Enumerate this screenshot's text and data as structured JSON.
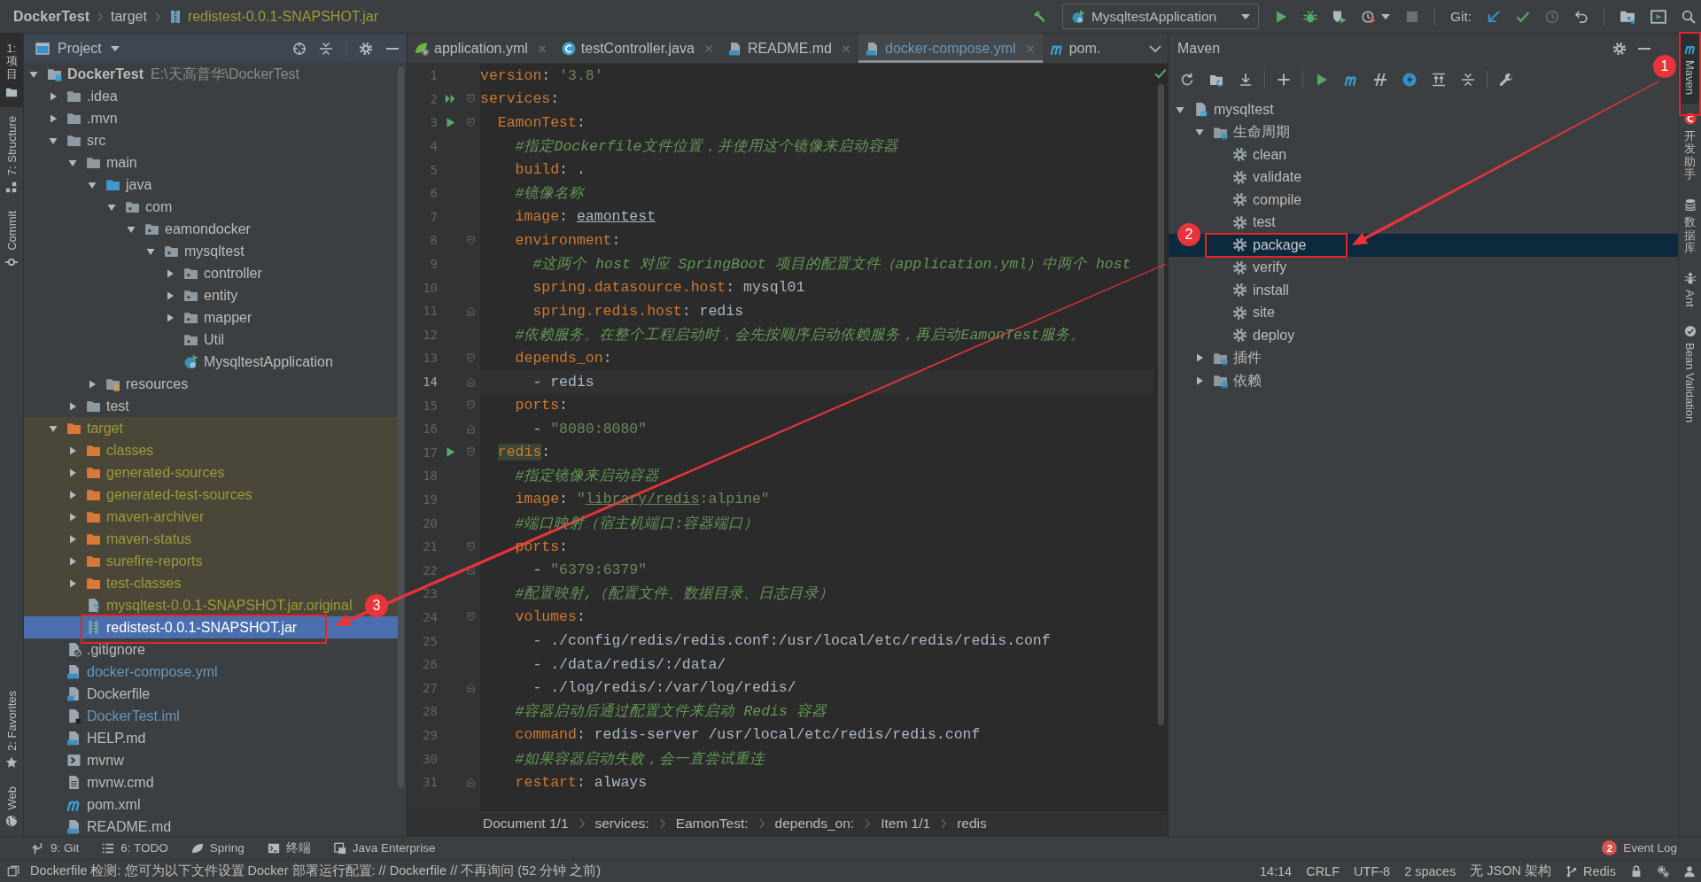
{
  "breadcrumb": [
    {
      "label": "DockerTest",
      "kind": "project"
    },
    {
      "label": "target",
      "kind": "folder"
    },
    {
      "label": "redistest-0.0.1-SNAPSHOT.jar",
      "kind": "jar"
    }
  ],
  "toolbar": {
    "run_config": "MysqltestApplication",
    "git_label": "Git:"
  },
  "left_strip": {
    "top": [
      {
        "label": "1: 项目",
        "kind": "project",
        "selected": true
      },
      {
        "label": "7: Structure",
        "kind": "structure",
        "selected": false
      },
      {
        "label": "Commit",
        "kind": "commit",
        "selected": false
      }
    ],
    "bottom": [
      {
        "label": "2: Favorites",
        "kind": "favorites",
        "selected": false
      },
      {
        "label": "Web",
        "kind": "web",
        "selected": false
      }
    ]
  },
  "project_panel": {
    "title": "Project",
    "tree": [
      {
        "label": "DockerTest",
        "path": "E:\\天高普华\\DockerTest",
        "kind": "module",
        "excluded": false,
        "modified": false,
        "expanded": true,
        "selected": false,
        "children": [
          {
            "label": ".idea",
            "kind": "folder",
            "excluded": false,
            "modified": false,
            "expanded": false,
            "selected": false
          },
          {
            "label": ".mvn",
            "kind": "folder",
            "excluded": false,
            "modified": false,
            "expanded": false,
            "selected": false
          },
          {
            "label": "src",
            "kind": "folder",
            "excluded": false,
            "modified": false,
            "expanded": true,
            "selected": false,
            "children": [
              {
                "label": "main",
                "kind": "folder",
                "excluded": false,
                "modified": false,
                "expanded": true,
                "selected": false,
                "children": [
                  {
                    "label": "java",
                    "kind": "source-root",
                    "excluded": false,
                    "modified": false,
                    "expanded": true,
                    "selected": false,
                    "children": [
                      {
                        "label": "com",
                        "kind": "package",
                        "excluded": false,
                        "modified": false,
                        "expanded": true,
                        "selected": false,
                        "children": [
                          {
                            "label": "eamondocker",
                            "kind": "package",
                            "excluded": false,
                            "modified": false,
                            "expanded": true,
                            "selected": false,
                            "children": [
                              {
                                "label": "mysqltest",
                                "kind": "package",
                                "excluded": false,
                                "modified": false,
                                "expanded": true,
                                "selected": false,
                                "children": [
                                  {
                                    "label": "controller",
                                    "kind": "package",
                                    "excluded": false,
                                    "modified": false,
                                    "expanded": false,
                                    "selected": false
                                  },
                                  {
                                    "label": "entity",
                                    "kind": "package",
                                    "excluded": false,
                                    "modified": false,
                                    "expanded": false,
                                    "selected": false
                                  },
                                  {
                                    "label": "mapper",
                                    "kind": "package",
                                    "excluded": false,
                                    "modified": false,
                                    "expanded": false,
                                    "selected": false
                                  },
                                  {
                                    "label": "Util",
                                    "kind": "package",
                                    "excluded": false,
                                    "modified": false,
                                    "selected": false
                                  },
                                  {
                                    "label": "MysqltestApplication",
                                    "kind": "spring-app",
                                    "excluded": false,
                                    "modified": false,
                                    "selected": false
                                  }
                                ]
                              }
                            ]
                          }
                        ]
                      }
                    ]
                  },
                  {
                    "label": "resources",
                    "kind": "resources-root",
                    "excluded": false,
                    "modified": false,
                    "expanded": false,
                    "selected": false
                  }
                ]
              },
              {
                "label": "test",
                "kind": "folder",
                "excluded": false,
                "modified": false,
                "expanded": false,
                "selected": false
              }
            ]
          },
          {
            "label": "target",
            "kind": "folder",
            "excluded": true,
            "modified": false,
            "expanded": true,
            "selected": false,
            "children": [
              {
                "label": "classes",
                "kind": "folder",
                "excluded": true,
                "modified": false,
                "expanded": false,
                "selected": false
              },
              {
                "label": "generated-sources",
                "kind": "folder",
                "excluded": true,
                "modified": false,
                "expanded": false,
                "selected": false
              },
              {
                "label": "generated-test-sources",
                "kind": "folder",
                "excluded": true,
                "modified": false,
                "expanded": false,
                "selected": false
              },
              {
                "label": "maven-archiver",
                "kind": "folder",
                "excluded": true,
                "modified": false,
                "expanded": false,
                "selected": false
              },
              {
                "label": "maven-status",
                "kind": "folder",
                "excluded": true,
                "modified": false,
                "expanded": false,
                "selected": false
              },
              {
                "label": "surefire-reports",
                "kind": "folder",
                "excluded": true,
                "modified": false,
                "expanded": false,
                "selected": false
              },
              {
                "label": "test-classes",
                "kind": "folder",
                "excluded": true,
                "modified": false,
                "expanded": false,
                "selected": false
              },
              {
                "label": "mysqltest-0.0.1-SNAPSHOT.jar.original",
                "kind": "unknown-file",
                "excluded": true,
                "modified": false,
                "selected": false
              },
              {
                "label": "redistest-0.0.1-SNAPSHOT.jar",
                "kind": "archive",
                "excluded": true,
                "modified": false,
                "selected": true
              }
            ]
          },
          {
            "label": ".gitignore",
            "kind": "ignore-file",
            "excluded": false,
            "modified": false,
            "selected": false
          },
          {
            "label": "docker-compose.yml",
            "kind": "compose-file",
            "excluded": false,
            "modified": true,
            "selected": false
          },
          {
            "label": "Dockerfile",
            "kind": "dockerfile",
            "excluded": false,
            "modified": false,
            "selected": false
          },
          {
            "label": "DockerTest.iml",
            "kind": "module-file",
            "excluded": false,
            "modified": true,
            "selected": false
          },
          {
            "label": "HELP.md",
            "kind": "markdown",
            "excluded": false,
            "modified": false,
            "selected": false
          },
          {
            "label": "mvnw",
            "kind": "shell-script",
            "excluded": false,
            "modified": false,
            "selected": false
          },
          {
            "label": "mvnw.cmd",
            "kind": "text-file",
            "excluded": false,
            "modified": false,
            "selected": false
          },
          {
            "label": "pom.xml",
            "kind": "maven-pom",
            "excluded": false,
            "modified": false,
            "selected": false
          },
          {
            "label": "README.md",
            "kind": "markdown",
            "excluded": false,
            "modified": false,
            "selected": false
          }
        ]
      }
    ]
  },
  "editor": {
    "tabs": [
      {
        "label": "application.yml",
        "kind": "spring-yaml",
        "modified": false,
        "selected": false,
        "closable": true
      },
      {
        "label": "testController.java",
        "kind": "class",
        "modified": false,
        "selected": false,
        "closable": true
      },
      {
        "label": "README.md",
        "kind": "markdown",
        "modified": false,
        "selected": false,
        "closable": true
      },
      {
        "label": "docker-compose.yml",
        "kind": "compose-file",
        "modified": true,
        "selected": true,
        "closable": true
      },
      {
        "label": "pom.",
        "kind": "maven-pom",
        "modified": false,
        "selected": false,
        "closable": false
      }
    ],
    "lines": [
      {
        "number": "1",
        "current": false,
        "run": false,
        "run_all": false,
        "fold_start": false,
        "fold_end": false,
        "tokens": [
          {
            "kind": "key",
            "text": "version"
          },
          {
            "kind": "plain",
            "text": ": "
          },
          {
            "kind": "string",
            "text": "'3.8'"
          }
        ]
      },
      {
        "number": "2",
        "current": false,
        "run": false,
        "run_all": true,
        "fold_start": true,
        "fold_end": false,
        "tokens": [
          {
            "kind": "key",
            "text": "services"
          },
          {
            "kind": "plain",
            "text": ":"
          }
        ]
      },
      {
        "number": "3",
        "current": false,
        "run": true,
        "run_all": false,
        "fold_start": true,
        "fold_end": false,
        "tokens": [
          {
            "kind": "key",
            "text": "  EamonTest"
          },
          {
            "kind": "plain",
            "text": ":"
          }
        ]
      },
      {
        "number": "4",
        "current": false,
        "run": false,
        "run_all": false,
        "fold_start": false,
        "fold_end": false,
        "tokens": [
          {
            "kind": "comment",
            "text": "    #指定Dockerfile文件位置，并使用这个镜像来启动容器"
          }
        ]
      },
      {
        "number": "5",
        "current": false,
        "run": false,
        "run_all": false,
        "fold_start": false,
        "fold_end": false,
        "tokens": [
          {
            "kind": "key",
            "text": "    build"
          },
          {
            "kind": "plain",
            "text": ": ."
          }
        ]
      },
      {
        "number": "6",
        "current": false,
        "run": false,
        "run_all": false,
        "fold_start": false,
        "fold_end": false,
        "tokens": [
          {
            "kind": "comment",
            "text": "    #镜像名称"
          }
        ]
      },
      {
        "number": "7",
        "current": false,
        "run": false,
        "run_all": false,
        "fold_start": false,
        "fold_end": false,
        "tokens": [
          {
            "kind": "key",
            "text": "    image"
          },
          {
            "kind": "plain",
            "text": ": "
          },
          {
            "kind": "link",
            "text": "eamontest"
          }
        ]
      },
      {
        "number": "8",
        "current": false,
        "run": false,
        "run_all": false,
        "fold_start": true,
        "fold_end": false,
        "tokens": [
          {
            "kind": "key",
            "text": "    environment"
          },
          {
            "kind": "plain",
            "text": ":"
          }
        ]
      },
      {
        "number": "9",
        "current": false,
        "run": false,
        "run_all": false,
        "fold_start": false,
        "fold_end": false,
        "tokens": [
          {
            "kind": "comment",
            "text": "      #这两个 host 对应 SpringBoot 项目的配置文件（application.yml）中两个 host"
          }
        ]
      },
      {
        "number": "10",
        "current": false,
        "run": false,
        "run_all": false,
        "fold_start": false,
        "fold_end": false,
        "tokens": [
          {
            "kind": "key",
            "text": "      spring.datasource.host"
          },
          {
            "kind": "plain",
            "text": ": mysql01"
          }
        ]
      },
      {
        "number": "11",
        "current": false,
        "run": false,
        "run_all": false,
        "fold_start": false,
        "fold_end": true,
        "tokens": [
          {
            "kind": "key",
            "text": "      spring.redis.host"
          },
          {
            "kind": "plain",
            "text": ": redis"
          }
        ]
      },
      {
        "number": "12",
        "current": false,
        "run": false,
        "run_all": false,
        "fold_start": false,
        "fold_end": false,
        "tokens": [
          {
            "kind": "comment",
            "text": "    #依赖服务。在整个工程启动时，会先按顺序启动依赖服务，再启动EamonTest服务。"
          }
        ]
      },
      {
        "number": "13",
        "current": false,
        "run": false,
        "run_all": false,
        "fold_start": true,
        "fold_end": false,
        "tokens": [
          {
            "kind": "key",
            "text": "    depends_on"
          },
          {
            "kind": "plain",
            "text": ":"
          }
        ]
      },
      {
        "number": "14",
        "current": true,
        "run": false,
        "run_all": false,
        "fold_start": false,
        "fold_end": true,
        "tokens": [
          {
            "kind": "plain",
            "text": "      - redis"
          }
        ]
      },
      {
        "number": "15",
        "current": false,
        "run": false,
        "run_all": false,
        "fold_start": true,
        "fold_end": false,
        "tokens": [
          {
            "kind": "key",
            "text": "    ports"
          },
          {
            "kind": "plain",
            "text": ":"
          }
        ]
      },
      {
        "number": "16",
        "current": false,
        "run": false,
        "run_all": false,
        "fold_start": false,
        "fold_end": true,
        "tokens": [
          {
            "kind": "plain",
            "text": "      - "
          },
          {
            "kind": "string",
            "text": "\"8080:8080\""
          }
        ]
      },
      {
        "number": "17",
        "current": false,
        "run": true,
        "run_all": false,
        "fold_start": true,
        "fold_end": false,
        "tokens": [
          {
            "kind": "key-marked",
            "text": "  redis"
          },
          {
            "kind": "plain",
            "text": ":"
          }
        ]
      },
      {
        "number": "18",
        "current": false,
        "run": false,
        "run_all": false,
        "fold_start": false,
        "fold_end": false,
        "tokens": [
          {
            "kind": "comment",
            "text": "    #指定镜像来启动容器"
          }
        ]
      },
      {
        "number": "19",
        "current": false,
        "run": false,
        "run_all": false,
        "fold_start": false,
        "fold_end": false,
        "tokens": [
          {
            "kind": "key",
            "text": "    image"
          },
          {
            "kind": "plain",
            "text": ": "
          },
          {
            "kind": "string",
            "text": "\""
          },
          {
            "kind": "string-link",
            "text": "library/redis"
          },
          {
            "kind": "string",
            "text": ":alpine\""
          }
        ]
      },
      {
        "number": "20",
        "current": false,
        "run": false,
        "run_all": false,
        "fold_start": false,
        "fold_end": false,
        "tokens": [
          {
            "kind": "comment",
            "text": "    #端口映射（宿主机端口:容器端口）"
          }
        ]
      },
      {
        "number": "21",
        "current": false,
        "run": false,
        "run_all": false,
        "fold_start": true,
        "fold_end": false,
        "tokens": [
          {
            "kind": "key",
            "text": "    ports"
          },
          {
            "kind": "plain",
            "text": ":"
          }
        ]
      },
      {
        "number": "22",
        "current": false,
        "run": false,
        "run_all": false,
        "fold_start": false,
        "fold_end": true,
        "tokens": [
          {
            "kind": "plain",
            "text": "      - "
          },
          {
            "kind": "string",
            "text": "\"6379:6379\""
          }
        ]
      },
      {
        "number": "23",
        "current": false,
        "run": false,
        "run_all": false,
        "fold_start": false,
        "fold_end": false,
        "tokens": [
          {
            "kind": "comment",
            "text": "    #配置映射,（配置文件、数据目录、日志目录）"
          }
        ]
      },
      {
        "number": "24",
        "current": false,
        "run": false,
        "run_all": false,
        "fold_start": true,
        "fold_end": false,
        "tokens": [
          {
            "kind": "key",
            "text": "    volumes"
          },
          {
            "kind": "plain",
            "text": ":"
          }
        ]
      },
      {
        "number": "25",
        "current": false,
        "run": false,
        "run_all": false,
        "fold_start": false,
        "fold_end": false,
        "tokens": [
          {
            "kind": "plain",
            "text": "      - ./config/redis/redis.conf:/usr/local/etc/redis/redis.conf"
          }
        ]
      },
      {
        "number": "26",
        "current": false,
        "run": false,
        "run_all": false,
        "fold_start": false,
        "fold_end": false,
        "tokens": [
          {
            "kind": "plain",
            "text": "      - ./data/redis/:/data/"
          }
        ]
      },
      {
        "number": "27",
        "current": false,
        "run": false,
        "run_all": false,
        "fold_start": false,
        "fold_end": true,
        "tokens": [
          {
            "kind": "plain",
            "text": "      - ./log/redis/:/var/log/redis/"
          }
        ]
      },
      {
        "number": "28",
        "current": false,
        "run": false,
        "run_all": false,
        "fold_start": false,
        "fold_end": false,
        "tokens": [
          {
            "kind": "comment",
            "text": "    #容器启动后通过配置文件来启动 Redis 容器"
          }
        ]
      },
      {
        "number": "29",
        "current": false,
        "run": false,
        "run_all": false,
        "fold_start": false,
        "fold_end": false,
        "tokens": [
          {
            "kind": "key",
            "text": "    command"
          },
          {
            "kind": "plain",
            "text": ": redis-server /usr/local/etc/redis/redis.conf"
          }
        ]
      },
      {
        "number": "30",
        "current": false,
        "run": false,
        "run_all": false,
        "fold_start": false,
        "fold_end": false,
        "tokens": [
          {
            "kind": "comment",
            "text": "    #如果容器启动失败，会一直尝试重连"
          }
        ]
      },
      {
        "number": "31",
        "current": false,
        "run": false,
        "run_all": false,
        "fold_start": false,
        "fold_end": true,
        "tokens": [
          {
            "kind": "key",
            "text": "    restart"
          },
          {
            "kind": "plain",
            "text": ": always"
          }
        ]
      }
    ],
    "breadcrumb": [
      "Document 1/1",
      "services:",
      "EamonTest:",
      "depends_on:",
      "Item 1/1",
      "redis"
    ]
  },
  "maven": {
    "title": "Maven",
    "tree": [
      {
        "label": "mysqltest",
        "kind": "maven-project",
        "expanded": true,
        "selected": false,
        "children": [
          {
            "label": "生命周期",
            "kind": "lifecycle",
            "expanded": true,
            "selected": false,
            "children": [
              {
                "label": "clean",
                "kind": "goal",
                "selected": false
              },
              {
                "label": "validate",
                "kind": "goal",
                "selected": false
              },
              {
                "label": "compile",
                "kind": "goal",
                "selected": false
              },
              {
                "label": "test",
                "kind": "goal",
                "selected": false
              },
              {
                "label": "package",
                "kind": "goal",
                "selected": true
              },
              {
                "label": "verify",
                "kind": "goal",
                "selected": false
              },
              {
                "label": "install",
                "kind": "goal",
                "selected": false
              },
              {
                "label": "site",
                "kind": "goal",
                "selected": false
              },
              {
                "label": "deploy",
                "kind": "goal",
                "selected": false
              }
            ]
          },
          {
            "label": "插件",
            "kind": "plugins",
            "expanded": false,
            "selected": false
          },
          {
            "label": "依赖",
            "kind": "dependencies",
            "expanded": false,
            "selected": false
          }
        ]
      }
    ]
  },
  "right_strip": [
    {
      "label": "Maven",
      "kind": "maven",
      "selected": true
    },
    {
      "label": "开发助手",
      "kind": "assistant",
      "selected": false
    },
    {
      "label": "数据库",
      "kind": "database",
      "selected": false
    },
    {
      "label": "Ant",
      "kind": "ant",
      "selected": false
    },
    {
      "label": "Bean Validation",
      "kind": "bean",
      "selected": false
    }
  ],
  "tool_windows": [
    {
      "label": "9: Git",
      "kind": "git"
    },
    {
      "label": "6: TODO",
      "kind": "todo"
    },
    {
      "label": "Spring",
      "kind": "spring"
    },
    {
      "label": "终端",
      "kind": "terminal"
    },
    {
      "label": "Java Enterprise",
      "kind": "java-ee"
    }
  ],
  "event_log": {
    "label": "Event Log",
    "count": "2"
  },
  "status_bar": {
    "message": "Dockerfile 检测: 您可为以下文件设置 Docker 部署运行配置: // Dockerfile // 不再询问 (52 分钟 之前)",
    "items": [
      "14:14",
      "CRLF",
      "UTF-8",
      "2 spaces",
      "无 JSON 架构"
    ],
    "branch": "Redis"
  },
  "annotations": [
    {
      "number": "1"
    },
    {
      "number": "2"
    },
    {
      "number": "3"
    }
  ]
}
